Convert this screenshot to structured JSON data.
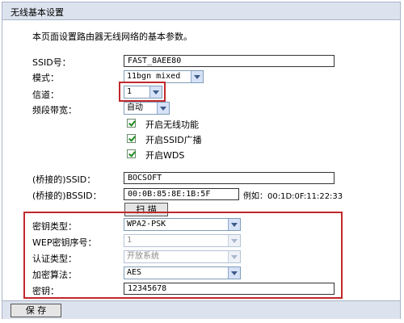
{
  "window": {
    "title": "无线基本设置"
  },
  "intro": "本页面设置路由器无线网络的基本参数。",
  "ssid": {
    "label": "SSID号：",
    "value": "FAST_8AEE80"
  },
  "mode": {
    "label": "模式：",
    "value": "11bgn mixed"
  },
  "channel": {
    "label": "信道：",
    "value": "1"
  },
  "bandwidth": {
    "label": "频段带宽：",
    "value": "自动"
  },
  "checkboxes": [
    {
      "label": "开启无线功能",
      "checked": true
    },
    {
      "label": "开启SSID广播",
      "checked": true
    },
    {
      "label": "开启WDS",
      "checked": true
    }
  ],
  "bridge": {
    "ssid_label": "(桥接的)SSID：",
    "ssid_value": "BOCSOFT",
    "bssid_label": "(桥接的)BSSID：",
    "bssid_value": "00:0B:85:8E:1B:5F",
    "example": "例如：00:1D:0F:11:22:33",
    "scan_button": "扫 描"
  },
  "security": {
    "key_type_label": "密钥类型：",
    "key_type_value": "WPA2-PSK",
    "wep_index_label": "WEP密钥序号：",
    "wep_index_value": "1",
    "auth_type_label": "认证类型：",
    "auth_type_value": "开放系统",
    "encryption_label": "加密算法：",
    "encryption_value": "AES",
    "key_label": "密钥：",
    "key_value": "12345678"
  },
  "save_button": "保 存",
  "colors": {
    "highlight": "#c0282b",
    "titlebar": "#dde3ee",
    "check": "#1e8a1e"
  }
}
